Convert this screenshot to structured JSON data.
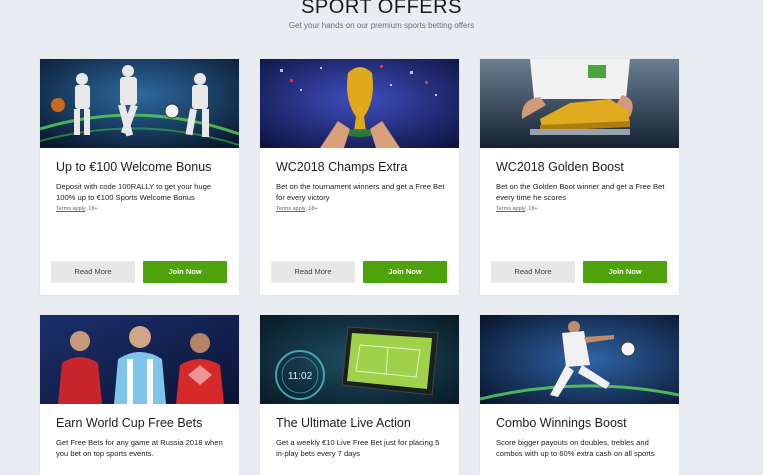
{
  "header": {
    "title": "SPORT OFFERS",
    "subtitle": "Get your hands on our premium sports betting offers"
  },
  "cards": [
    {
      "title": "Up to €100 Welcome Bonus",
      "desc": "Deposit with code 100RALLY to get your huge 100% up to €100 Sports Welcome Bonus",
      "terms_link": "Terms apply",
      "terms_rest": ", 18+",
      "more": "Read More",
      "join": "Join Now"
    },
    {
      "title": "WC2018 Champs Extra",
      "desc": "Bet on the tournament winners and get a Free Bet for every victory",
      "terms_link": "Terms apply",
      "terms_rest": ", 18+",
      "more": "Read More",
      "join": "Join Now"
    },
    {
      "title": "WC2018 Golden Boost",
      "desc": "Bet on the Golden Boot winner and get a Free Bet every time he scores",
      "terms_link": "Terms apply",
      "terms_rest": ", 18+",
      "more": "Read More",
      "join": "Join Now"
    },
    {
      "title": "Earn World Cup Free Bets",
      "desc": "Get Free Bets for any game at Russia 2018 when you bet on top sports events."
    },
    {
      "title": "The Ultimate Live Action",
      "desc": "Get a weekly €10 Live Free Bet just for placing 5 in-play bets every 7 days",
      "phone_time": "11:02"
    },
    {
      "title": "Combo Winnings Boost",
      "desc": "Score bigger payouts on doubles, trebles and combos with up to 60% extra cash on all sports"
    }
  ],
  "colors": {
    "page_bg": "#e9edf1",
    "join_button": "#4ea30d",
    "more_button": "#e7e7e7"
  }
}
